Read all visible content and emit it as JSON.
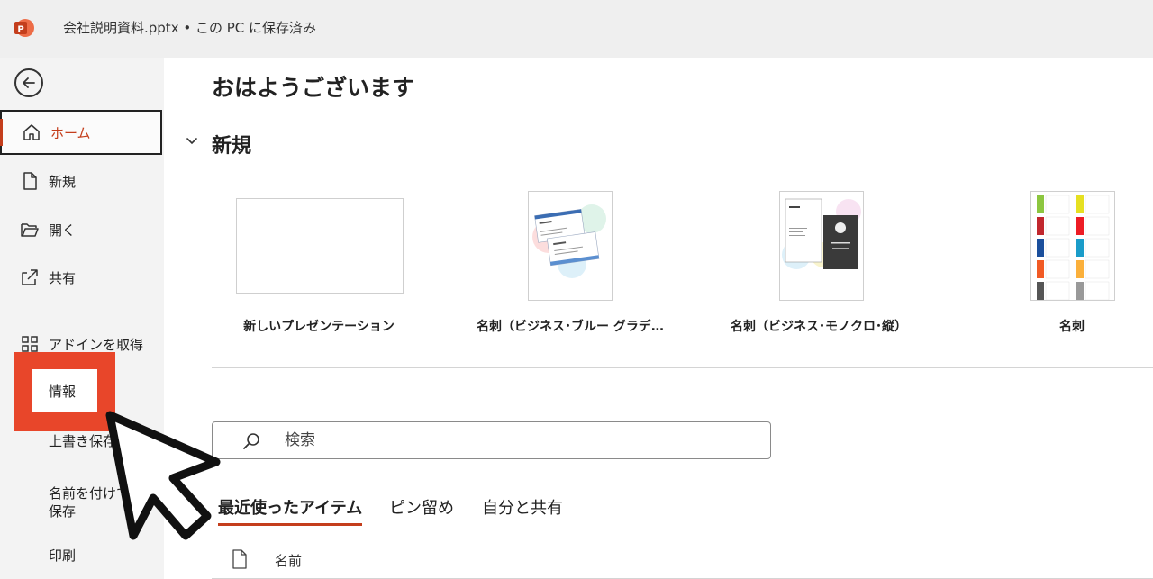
{
  "titlebar": {
    "title": "会社説明資料.pptx • この PC に保存済み"
  },
  "sidebar": {
    "items": [
      {
        "label": "ホーム",
        "icon": "home-icon"
      },
      {
        "label": "新規",
        "icon": "new-file-icon"
      },
      {
        "label": "開く",
        "icon": "folder-open-icon"
      },
      {
        "label": "共有",
        "icon": "share-icon"
      },
      {
        "label": "アドインを取得",
        "icon": "apps-grid-icon"
      },
      {
        "label": "情報"
      },
      {
        "label": "上書き保存"
      },
      {
        "label": "名前を付けて保存"
      },
      {
        "label": "印刷"
      }
    ]
  },
  "main": {
    "greeting": "おはようございます",
    "new_section_title": "新規",
    "templates": [
      {
        "label": "新しいプレゼンテーション"
      },
      {
        "label": "名刺（ビジネス･ブルー グラデ…"
      },
      {
        "label": "名刺（ビジネス･モノクロ･縦）"
      },
      {
        "label": "名刺"
      }
    ],
    "search": {
      "placeholder": "検索"
    },
    "tabs": [
      {
        "label": "最近使ったアイテム"
      },
      {
        "label": "ピン留め"
      },
      {
        "label": "自分と共有"
      }
    ],
    "file_list": {
      "name_header": "名前"
    }
  },
  "colors": {
    "accent": "#c43e1c",
    "highlight": "#e8462a"
  }
}
